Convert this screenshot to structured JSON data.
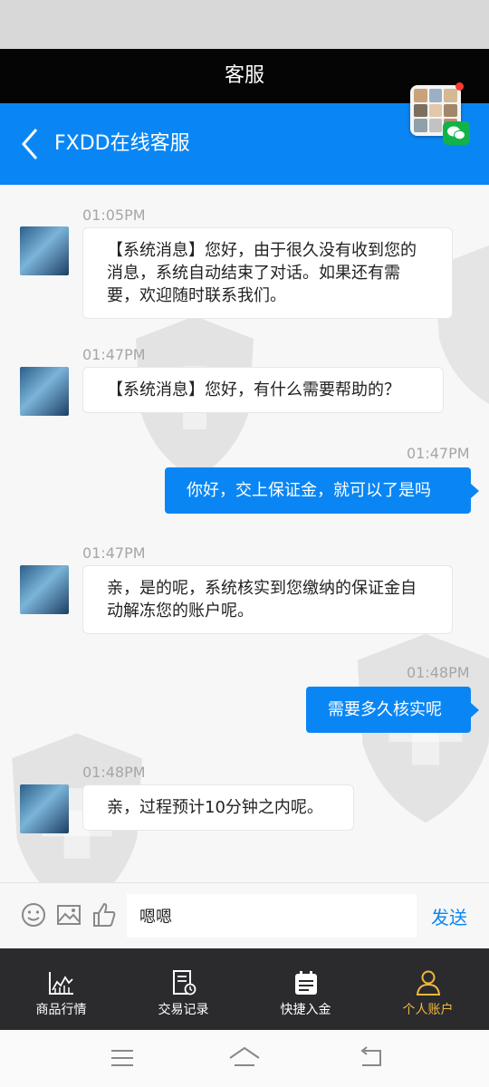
{
  "topbar": {
    "title": "客服"
  },
  "header": {
    "title": "FXDD在线客服"
  },
  "messages": [
    {
      "direction": "in",
      "time": "01:05PM",
      "text": "【系统消息】您好，由于很久没有收到您的消息，系统自动结束了对话。如果还有需要，欢迎随时联系我们。"
    },
    {
      "direction": "in",
      "time": "01:47PM",
      "text": "【系统消息】您好，有什么需要帮助的？"
    },
    {
      "direction": "out",
      "time": "01:47PM",
      "text": "你好，交上保证金，就可以了是吗"
    },
    {
      "direction": "in",
      "time": "01:47PM",
      "text": "亲，是的呢，系统核实到您缴纳的保证金自动解冻您的账户呢。"
    },
    {
      "direction": "out",
      "time": "01:48PM",
      "text": "需要多久核实呢"
    },
    {
      "direction": "in",
      "time": "01:48PM",
      "text": "亲，过程预计10分钟之内呢。"
    }
  ],
  "composer": {
    "value": "嗯嗯",
    "send_label": "发送"
  },
  "tabs": [
    {
      "label": "商品行情",
      "icon": "chart-icon",
      "active": false
    },
    {
      "label": "交易记录",
      "icon": "record-icon",
      "active": false
    },
    {
      "label": "快捷入金",
      "icon": "deposit-icon",
      "active": false
    },
    {
      "label": "个人账户",
      "icon": "person-icon",
      "active": true
    }
  ],
  "colors": {
    "brand_blue": "#0a86f4",
    "active_tab": "#f0b83c",
    "tabbar_bg": "#2b2b2e",
    "wechat_green": "#12b24a"
  }
}
